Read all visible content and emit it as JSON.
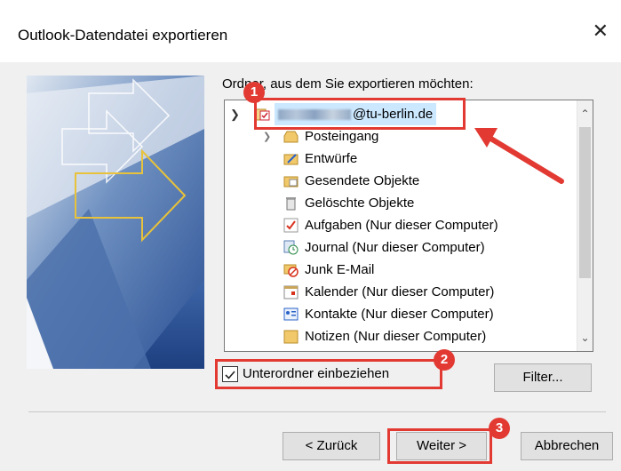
{
  "window": {
    "title": "Outlook-Datendatei exportieren",
    "close_glyph": "✕"
  },
  "folder_label": "Ordner, aus dem Sie exportieren möchten:",
  "tree": {
    "account": "@tu-berlin.de",
    "items": [
      {
        "label": "Posteingang",
        "icon": "inbox-icon"
      },
      {
        "label": "Entwürfe",
        "icon": "drafts-icon"
      },
      {
        "label": "Gesendete Objekte",
        "icon": "sent-items-icon"
      },
      {
        "label": "Gelöschte Objekte",
        "icon": "trash-icon"
      },
      {
        "label": "Aufgaben (Nur dieser Computer)",
        "icon": "tasks-icon"
      },
      {
        "label": "Journal (Nur dieser Computer)",
        "icon": "journal-icon"
      },
      {
        "label": "Junk E-Mail",
        "icon": "junk-mail-icon"
      },
      {
        "label": "Kalender (Nur dieser Computer)",
        "icon": "calendar-icon"
      },
      {
        "label": "Kontakte (Nur dieser Computer)",
        "icon": "contacts-icon"
      },
      {
        "label": "Notizen (Nur dieser Computer)",
        "icon": "notes-icon"
      }
    ]
  },
  "include_subfolders": {
    "label": "Unterordner einbeziehen",
    "checked": true
  },
  "buttons": {
    "filter": "Filter...",
    "back": "< Zurück",
    "next": "Weiter >",
    "cancel": "Abbrechen"
  },
  "annotations": {
    "badge1": "1",
    "badge2": "2",
    "badge3": "3"
  },
  "colors": {
    "highlight": "#e23a33",
    "selection": "#cce8ff"
  }
}
